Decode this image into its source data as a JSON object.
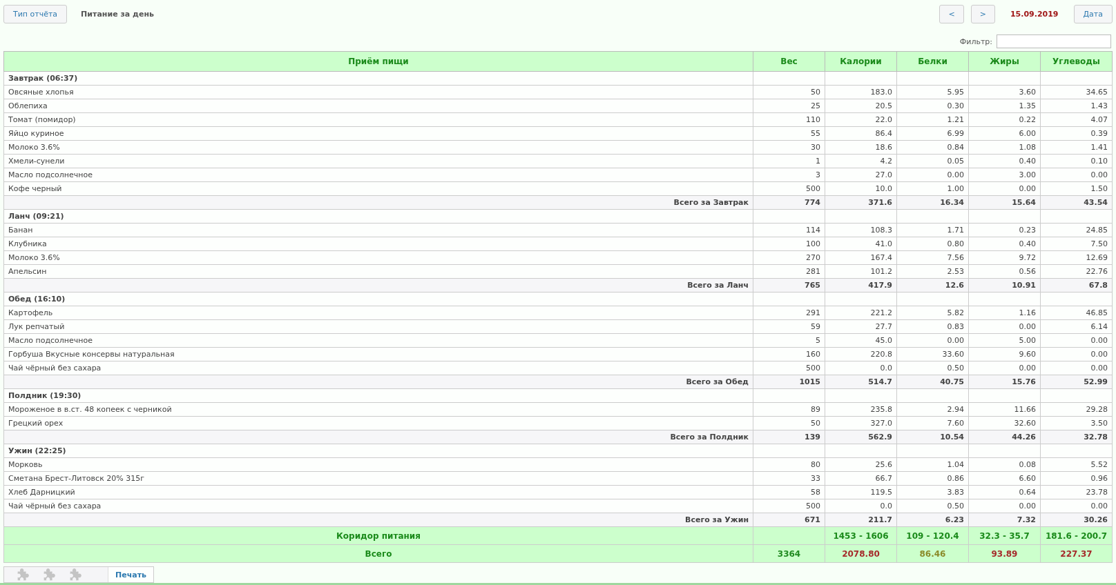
{
  "header": {
    "report_type_button": "Тип отчёта",
    "title": "Питание за день",
    "prev_button": "<",
    "next_button": ">",
    "date": "15.09.2019",
    "date_button": "Дата"
  },
  "filter": {
    "label": "Фильтр:"
  },
  "columns": [
    "Приём пищи",
    "Вес",
    "Калории",
    "Белки",
    "Жиры",
    "Углеводы"
  ],
  "meals": [
    {
      "title": "Завтрак (06:37)",
      "items": [
        {
          "name": "Овсяные хлопья",
          "values": [
            "50",
            "183.0",
            "5.95",
            "3.60",
            "34.65"
          ]
        },
        {
          "name": "Облепиха",
          "values": [
            "25",
            "20.5",
            "0.30",
            "1.35",
            "1.43"
          ]
        },
        {
          "name": "Томат (помидор)",
          "values": [
            "110",
            "22.0",
            "1.21",
            "0.22",
            "4.07"
          ]
        },
        {
          "name": "Яйцо куриное",
          "values": [
            "55",
            "86.4",
            "6.99",
            "6.00",
            "0.39"
          ]
        },
        {
          "name": "Молоко 3.6%",
          "values": [
            "30",
            "18.6",
            "0.84",
            "1.08",
            "1.41"
          ]
        },
        {
          "name": "Хмели-сунели",
          "values": [
            "1",
            "4.2",
            "0.05",
            "0.40",
            "0.10"
          ]
        },
        {
          "name": "Масло подсолнечное",
          "values": [
            "3",
            "27.0",
            "0.00",
            "3.00",
            "0.00"
          ]
        },
        {
          "name": "Кофе черный",
          "values": [
            "500",
            "10.0",
            "1.00",
            "0.00",
            "1.50"
          ]
        }
      ],
      "total": {
        "label": "Всего за Завтрак",
        "values": [
          "774",
          "371.6",
          "16.34",
          "15.64",
          "43.54"
        ]
      }
    },
    {
      "title": "Ланч (09:21)",
      "items": [
        {
          "name": "Банан",
          "values": [
            "114",
            "108.3",
            "1.71",
            "0.23",
            "24.85"
          ]
        },
        {
          "name": "Клубника",
          "values": [
            "100",
            "41.0",
            "0.80",
            "0.40",
            "7.50"
          ]
        },
        {
          "name": "Молоко 3.6%",
          "values": [
            "270",
            "167.4",
            "7.56",
            "9.72",
            "12.69"
          ]
        },
        {
          "name": "Апельсин",
          "values": [
            "281",
            "101.2",
            "2.53",
            "0.56",
            "22.76"
          ]
        }
      ],
      "total": {
        "label": "Всего за Ланч",
        "values": [
          "765",
          "417.9",
          "12.6",
          "10.91",
          "67.8"
        ]
      }
    },
    {
      "title": "Обед (16:10)",
      "items": [
        {
          "name": "Картофель",
          "values": [
            "291",
            "221.2",
            "5.82",
            "1.16",
            "46.85"
          ]
        },
        {
          "name": "Лук репчатый",
          "values": [
            "59",
            "27.7",
            "0.83",
            "0.00",
            "6.14"
          ]
        },
        {
          "name": "Масло подсолнечное",
          "values": [
            "5",
            "45.0",
            "0.00",
            "5.00",
            "0.00"
          ]
        },
        {
          "name": "Горбуша Вкусные консервы натуральная",
          "values": [
            "160",
            "220.8",
            "33.60",
            "9.60",
            "0.00"
          ]
        },
        {
          "name": "Чай чёрный без сахара",
          "values": [
            "500",
            "0.0",
            "0.50",
            "0.00",
            "0.00"
          ]
        }
      ],
      "total": {
        "label": "Всего за Обед",
        "values": [
          "1015",
          "514.7",
          "40.75",
          "15.76",
          "52.99"
        ]
      }
    },
    {
      "title": "Полдник (19:30)",
      "items": [
        {
          "name": "Мороженое в в.ст. 48 копеек с черникой",
          "values": [
            "89",
            "235.8",
            "2.94",
            "11.66",
            "29.28"
          ]
        },
        {
          "name": "Грецкий орех",
          "values": [
            "50",
            "327.0",
            "7.60",
            "32.60",
            "3.50"
          ]
        }
      ],
      "total": {
        "label": "Всего за Полдник",
        "values": [
          "139",
          "562.9",
          "10.54",
          "44.26",
          "32.78"
        ]
      }
    },
    {
      "title": "Ужин (22:25)",
      "items": [
        {
          "name": "Морковь",
          "values": [
            "80",
            "25.6",
            "1.04",
            "0.08",
            "5.52"
          ]
        },
        {
          "name": "Сметана Брест-Литовск 20% 315г",
          "values": [
            "33",
            "66.7",
            "0.86",
            "6.60",
            "0.96"
          ]
        },
        {
          "name": "Хлеб Дарницкий",
          "values": [
            "58",
            "119.5",
            "3.83",
            "0.64",
            "23.78"
          ]
        },
        {
          "name": "Чай чёрный без сахара",
          "values": [
            "500",
            "0.0",
            "0.50",
            "0.00",
            "0.00"
          ]
        }
      ],
      "total": {
        "label": "Всего за Ужин",
        "values": [
          "671",
          "211.7",
          "6.23",
          "7.32",
          "30.26"
        ]
      }
    }
  ],
  "corridor": {
    "label": "Коридор питания",
    "values": [
      "1453 - 1606",
      "109 - 120.4",
      "32.3 - 35.7",
      "181.6 - 200.7"
    ]
  },
  "grand_total": {
    "label": "Всего",
    "values": [
      {
        "text": "3364",
        "color": "#228b22"
      },
      {
        "text": "2078.80",
        "color": "#a52a2a"
      },
      {
        "text": "86.46",
        "color": "#8b8b2a"
      },
      {
        "text": "93.89",
        "color": "#a52a2a"
      },
      {
        "text": "227.37",
        "color": "#a52a2a"
      }
    ]
  },
  "footer": {
    "plugins": [
      {
        "disabled": true
      },
      {
        "disabled": true
      },
      {
        "disabled": true
      }
    ],
    "print_button": "Печать"
  }
}
